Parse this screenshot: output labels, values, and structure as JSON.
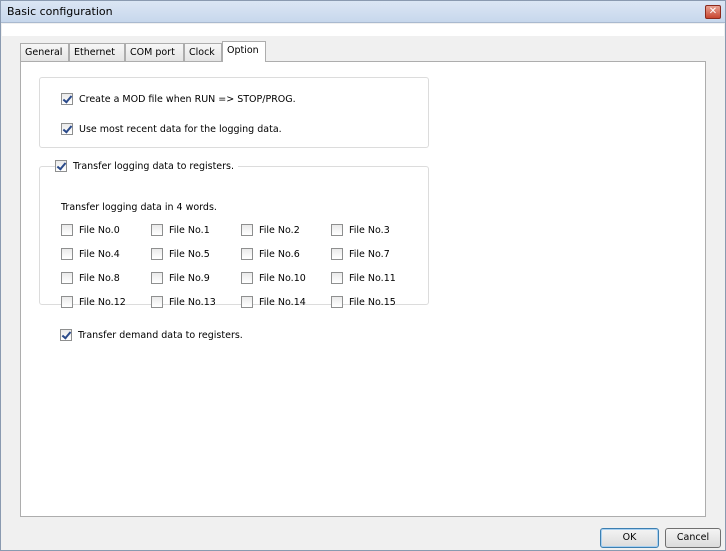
{
  "window": {
    "title": "Basic configuration",
    "close_glyph": "✕"
  },
  "tabs": [
    {
      "label": "General",
      "active": false
    },
    {
      "label": "Ethernet",
      "active": false
    },
    {
      "label": "COM port",
      "active": false
    },
    {
      "label": "Clock",
      "active": false
    },
    {
      "label": "Option",
      "active": true
    }
  ],
  "options": {
    "create_mod": {
      "label": "Create a MOD file when RUN => STOP/PROG.",
      "checked": true
    },
    "recent_data": {
      "label": "Use most recent data for the logging data.",
      "checked": true
    }
  },
  "logging": {
    "transfer": {
      "label": "Transfer logging data to registers.",
      "checked": true
    },
    "words_text": "Transfer logging data in 4 words.",
    "files": [
      [
        "File No.0",
        "File No.1",
        "File No.2",
        "File No.3"
      ],
      [
        "File No.4",
        "File No.5",
        "File No.6",
        "File No.7"
      ],
      [
        "File No.8",
        "File No.9",
        "File No.10",
        "File No.11"
      ],
      [
        "File No.12",
        "File No.13",
        "File No.14",
        "File No.15"
      ]
    ]
  },
  "demand": {
    "label": "Transfer demand data to registers.",
    "checked": true
  },
  "buttons": {
    "ok": "OK",
    "cancel": "Cancel"
  }
}
